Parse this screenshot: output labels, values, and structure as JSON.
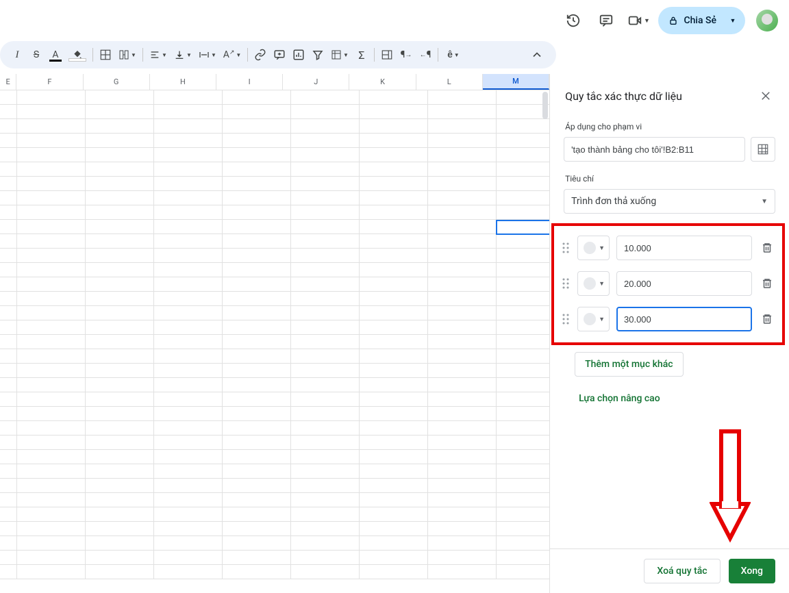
{
  "topbar": {
    "share_label": "Chia Sẻ"
  },
  "columns": [
    "E",
    "F",
    "G",
    "H",
    "I",
    "J",
    "K",
    "L",
    "M"
  ],
  "selected_column": "M",
  "panel": {
    "title": "Quy tắc xác thực dữ liệu",
    "apply_label": "Áp dụng cho phạm vi",
    "range_value": "'tạo thành bảng cho tôi'!B2:B11",
    "criteria_label": "Tiêu chí",
    "criteria_value": "Trình đơn thả xuống",
    "options": [
      {
        "value": "10.000"
      },
      {
        "value": "20.000"
      },
      {
        "value": "30.000"
      }
    ],
    "add_item_label": "Thêm một mục khác",
    "advanced_label": "Lựa chọn nâng cao",
    "remove_label": "Xoá quy tắc",
    "done_label": "Xong"
  }
}
